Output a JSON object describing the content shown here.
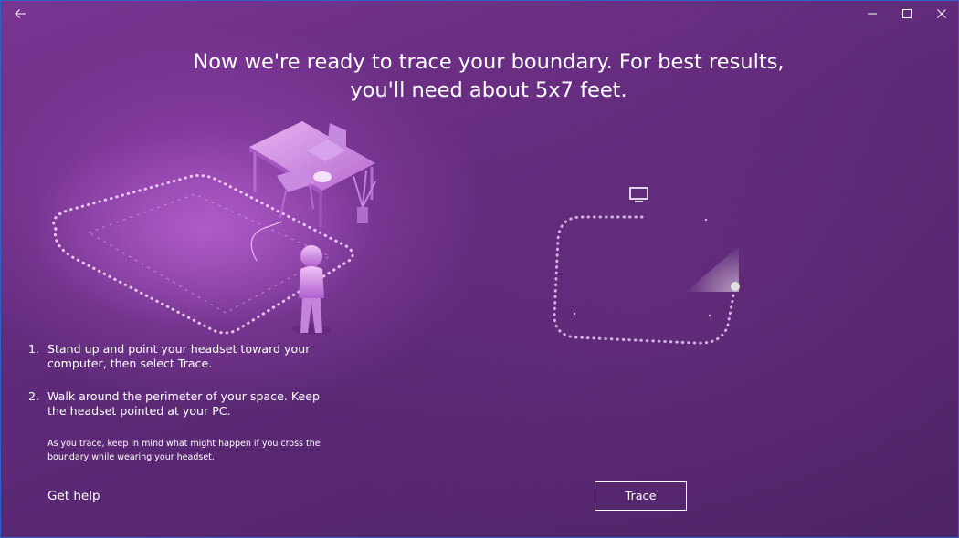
{
  "window": {
    "back_icon": "back-arrow-icon",
    "minimize_icon": "minimize-icon",
    "maximize_icon": "maximize-icon",
    "close_icon": "close-icon"
  },
  "headline": {
    "line1": "Now we're ready to trace your boundary. For best results,",
    "line2": "you'll need about 5x7 feet."
  },
  "instructions": [
    {
      "number": "1.",
      "text": "Stand up and point your headset toward your computer, then select Trace."
    },
    {
      "number": "2.",
      "text": "Walk around the perimeter of your space. Keep the headset pointed at your PC."
    }
  ],
  "note": "As you trace, keep in mind what might happen if you cross the boundary while wearing your headset.",
  "get_help_label": "Get help",
  "trace_button_label": "Trace",
  "graphics": {
    "illustration": "room-boundary-illustration",
    "trace_preview": "boundary-trace-preview",
    "monitor_icon": "monitor-icon"
  },
  "colors": {
    "background_top": "#7a3492",
    "background_bottom": "#4d2466",
    "text": "#ffffff",
    "window_border": "#2f62c9"
  }
}
